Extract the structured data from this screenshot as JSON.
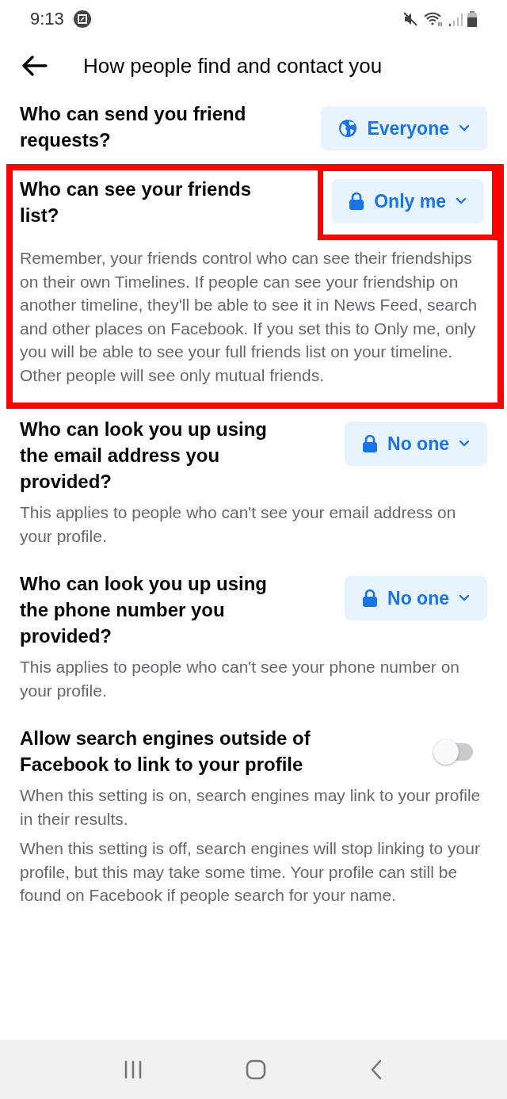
{
  "status_bar": {
    "time": "9:13"
  },
  "header": {
    "title": "How people find and contact you"
  },
  "settings": [
    {
      "kind": "dropdown",
      "question": "Who can send you friend requests?",
      "value": "Everyone",
      "highlighted": false,
      "dropdown_highlighted": false
    },
    {
      "kind": "dropdown",
      "question": "Who can see your friends list?",
      "value": "Only me",
      "highlighted": true,
      "dropdown_highlighted": true,
      "descriptions": [
        "Remember, your friends control who can see their friendships on their own Timelines. If people can see your friendship on another timeline, they'll be able to see it in News Feed, search and other places on Facebook. If you set this to Only me, only you will be able to see your full friends list on your timeline. Other people will see only mutual friends."
      ]
    },
    {
      "kind": "dropdown",
      "question": "Who can look you up using the email address you provided?",
      "value": "No one",
      "highlighted": false,
      "dropdown_highlighted": false,
      "descriptions": [
        "This applies to people who can't see your email address on your profile."
      ]
    },
    {
      "kind": "dropdown",
      "question": "Who can look you up using the phone number you provided?",
      "value": "No one",
      "highlighted": false,
      "dropdown_highlighted": false,
      "descriptions": [
        "This applies to people who can't see your phone number on your profile."
      ]
    },
    {
      "kind": "toggle",
      "question": "Allow search engines outside of Facebook to link to your profile",
      "on": false,
      "highlighted": false,
      "descriptions": [
        "When this setting is on, search engines may link to your profile in their results.",
        "When this setting is off, search engines will stop linking to your profile, but this may take some time. Your profile can still be found on Facebook if people search for your name."
      ]
    }
  ]
}
